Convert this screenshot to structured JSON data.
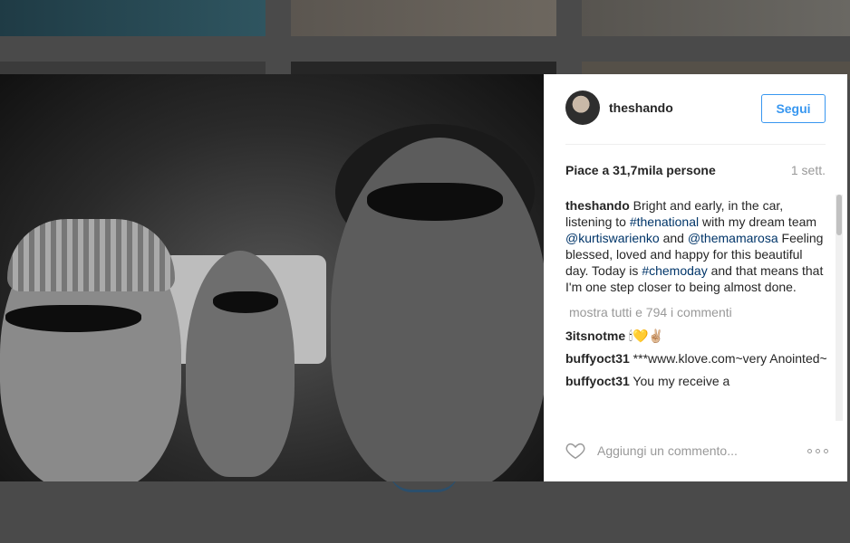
{
  "post": {
    "username": "theshando",
    "follow_label": "Segui",
    "likes_text": "Piace a 31,7mila persone",
    "time_ago": "1 sett.",
    "caption": {
      "username": "theshando",
      "t1": " Bright and early, in the car, listening to ",
      "tag1": "#thenational",
      "t2": " with my dream team ",
      "mention1": "@kurtiswarienko",
      "t3": " and ",
      "mention2": "@themamarosa",
      "t4": " Feeling blessed, loved and happy for this beautiful day. Today is ",
      "tag2": "#chemoday",
      "t5": " and that means that I'm one step closer to being almost done."
    },
    "load_more": "mostra tutti e 794 i commenti",
    "comments": [
      {
        "username": "3itsnotme",
        "text": " 🕯💛✌🏼"
      },
      {
        "username": "buffyoct31",
        "text": " ***www.klove.com~very Anointed~"
      },
      {
        "username": "buffyoct31",
        "text": " You my receive a"
      }
    ],
    "add_comment_placeholder": "Aggiungi un commento...",
    "icons": {
      "like": "heart-icon",
      "more": "more-options-icon"
    },
    "colors": {
      "accent": "#3897f0",
      "link": "#003569",
      "muted": "#999999"
    }
  }
}
